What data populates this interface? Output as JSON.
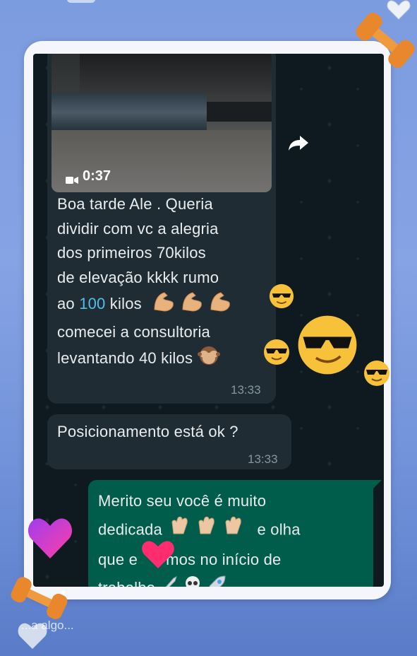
{
  "video": {
    "duration": "0:37"
  },
  "messages": {
    "first": {
      "lines": [
        "Boa tarde Ale . Queria",
        "dividir com vc a alegria",
        "dos primeiros 70kilos",
        "de elevação kkkk  rumo",
        "ao ",
        "100",
        " kilos",
        "comecei a consultoria",
        "levantando 40 kilos"
      ],
      "time": "13:33"
    },
    "second": {
      "text": "Posicionamento está ok ?",
      "time": "13:33"
    },
    "reply": {
      "line1": "Merito seu você é muito",
      "line2": "dedicada",
      "line2_tail": "e olha",
      "line3a": "que e",
      "line3b": "mos no início de",
      "line4": "trabalho"
    }
  },
  "story": {
    "reply_placeholder": "...a algo..."
  },
  "icons": [
    "video-camera-icon",
    "forward-icon",
    "flexed-biceps-emoji",
    "see-no-evil-monkey-emoji",
    "clapping-hands-emoji",
    "knife-emoji",
    "skull-emoji",
    "rocket-emoji",
    "sunglasses-face-emoji",
    "dumbbell-sticker",
    "heart-sticker"
  ],
  "colors": {
    "chat_bg": "#0f1a20",
    "incoming_bubble": "#1f2c34",
    "outgoing_bubble": "#005c4b",
    "mention": "#53bdeb",
    "timestamp": "#8696a0",
    "story_bg": "#7c9ce0"
  }
}
